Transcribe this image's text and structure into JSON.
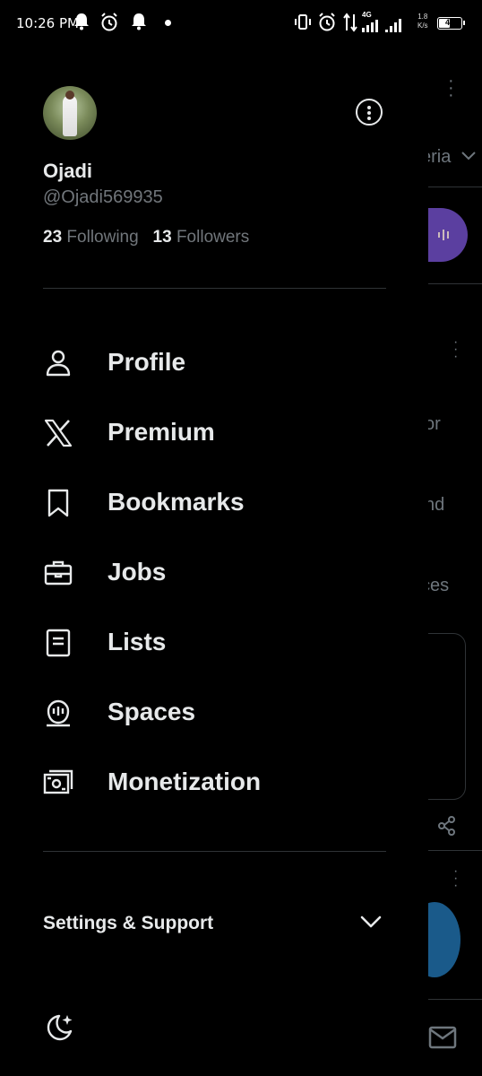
{
  "status_bar": {
    "time": "10:26 PM",
    "network": "4G",
    "speed_value": "1.8",
    "speed_unit": "K/s",
    "battery": "45"
  },
  "profile": {
    "name": "Ojadi",
    "handle": "@Ojadi569935",
    "following_count": "23",
    "following_label": "Following",
    "followers_count": "13",
    "followers_label": "Followers"
  },
  "menu": [
    {
      "label": "Profile",
      "icon": "person-icon"
    },
    {
      "label": "Premium",
      "icon": "x-logo-icon"
    },
    {
      "label": "Bookmarks",
      "icon": "bookmark-icon"
    },
    {
      "label": "Jobs",
      "icon": "briefcase-icon"
    },
    {
      "label": "Lists",
      "icon": "list-icon"
    },
    {
      "label": "Spaces",
      "icon": "spaces-icon"
    },
    {
      "label": "Monetization",
      "icon": "money-icon"
    }
  ],
  "settings": {
    "label": "Settings & Support"
  },
  "background_fragments": [
    "eria",
    "or",
    "nd",
    "ces"
  ]
}
